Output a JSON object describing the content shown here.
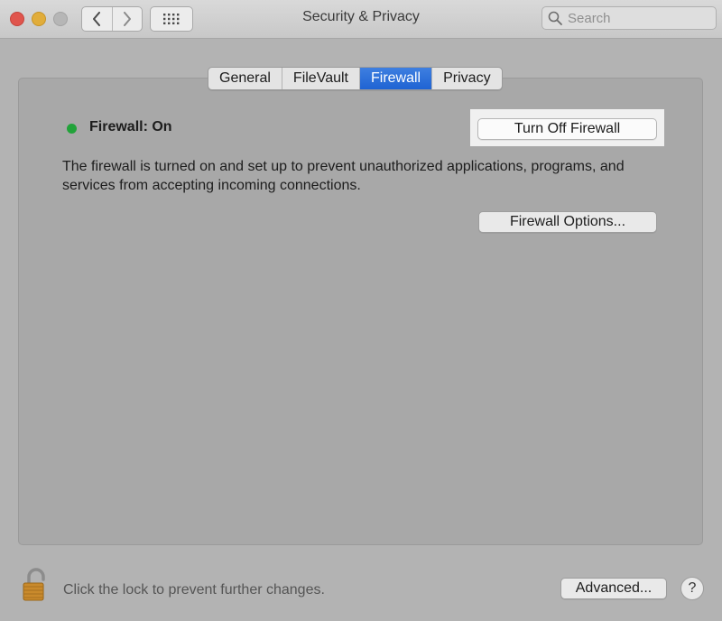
{
  "window": {
    "title": "Security & Privacy",
    "traffic_lights": {
      "close": "#e0554d",
      "minimize": "#e1ad3b",
      "zoom": "#b6b6b6"
    }
  },
  "toolbar": {
    "back_icon": "chevron-left-icon",
    "forward_icon": "chevron-right-icon",
    "show_all_icon": "grid-icon",
    "search_placeholder": "Search"
  },
  "tabs": [
    {
      "label": "General",
      "active": false
    },
    {
      "label": "FileVault",
      "active": false
    },
    {
      "label": "Firewall",
      "active": true
    },
    {
      "label": "Privacy",
      "active": false
    }
  ],
  "firewall": {
    "status_label": "Firewall: On",
    "status_color": "#22a33a",
    "toggle_button": "Turn Off Firewall",
    "description": "The firewall is turned on and set up to prevent unauthorized applications, programs, and services from accepting incoming connections.",
    "options_button": "Firewall Options..."
  },
  "footer": {
    "lock_icon": "unlocked-padlock-icon",
    "lock_text": "Click the lock to prevent further changes.",
    "advanced_button": "Advanced...",
    "help_label": "?"
  },
  "accent_color": "#1f63d3"
}
